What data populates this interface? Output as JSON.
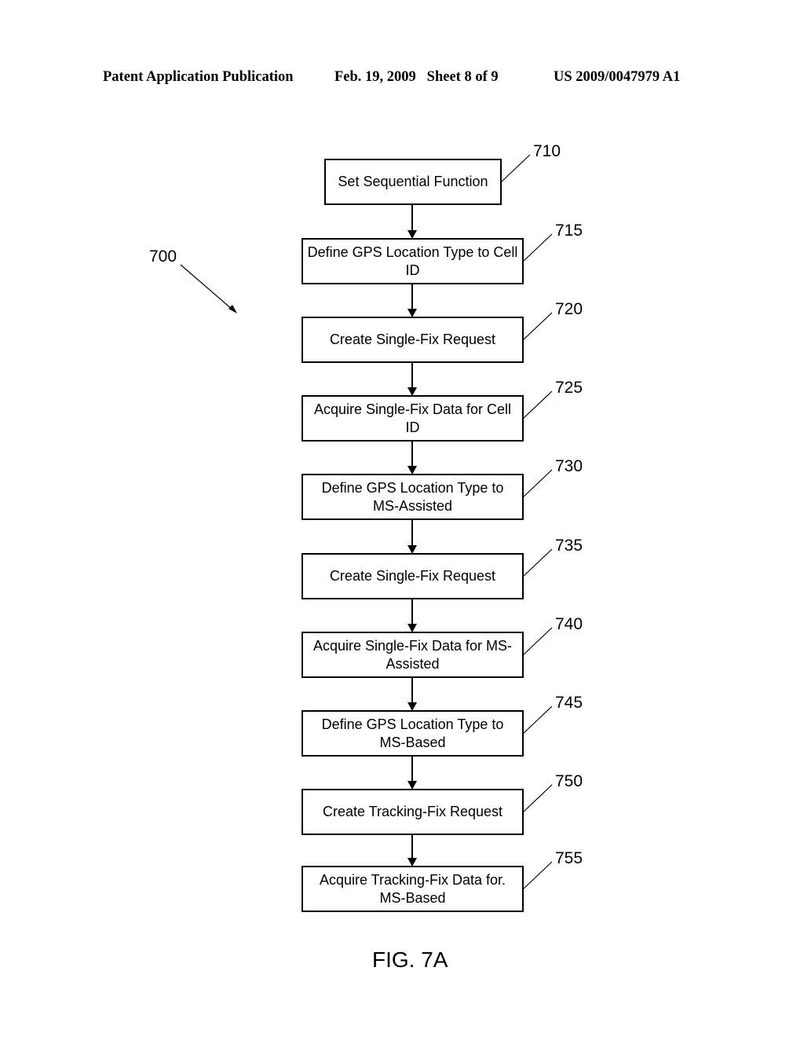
{
  "header": {
    "publication": "Patent Application Publication",
    "date_sheet": "Feb. 19, 2009   Sheet 8 of 9",
    "patent_number": "US 2009/0047979 A1"
  },
  "diagram": {
    "reference": "700",
    "caption": "FIG. 7A",
    "steps": [
      {
        "ref": "710",
        "label": "Set Sequential Function"
      },
      {
        "ref": "715",
        "label": "Define GPS Location Type to Cell ID"
      },
      {
        "ref": "720",
        "label": "Create Single-Fix Request"
      },
      {
        "ref": "725",
        "label": "Acquire Single-Fix Data for Cell ID"
      },
      {
        "ref": "730",
        "label": "Define GPS Location Type to MS-Assisted"
      },
      {
        "ref": "735",
        "label": "Create Single-Fix Request"
      },
      {
        "ref": "740",
        "label": "Acquire Single-Fix Data for MS-Assisted"
      },
      {
        "ref": "745",
        "label": "Define GPS Location Type to MS-Based"
      },
      {
        "ref": "750",
        "label": "Create Tracking-Fix Request"
      },
      {
        "ref": "755",
        "label": "Acquire Tracking-Fix Data for. MS-Based"
      }
    ]
  }
}
